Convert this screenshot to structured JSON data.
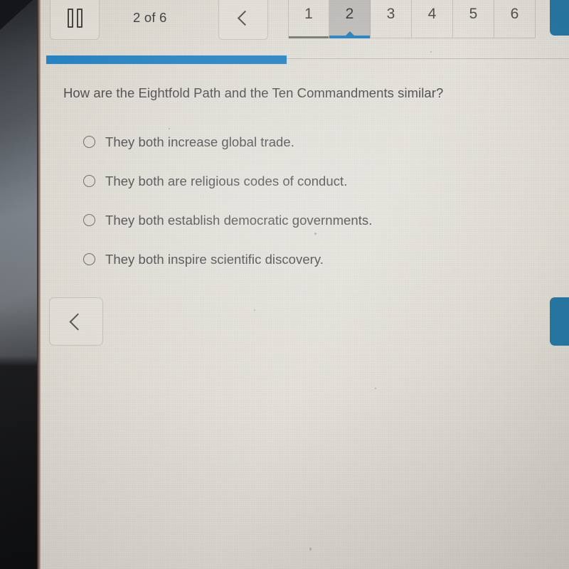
{
  "toolbar": {
    "pause_icon": "pause-icon",
    "pause_label": "",
    "counter_text": "2 of 6",
    "prev_icon": "chevron-left-icon",
    "next_icon": "chevron-right-icon"
  },
  "pagination": {
    "tabs": [
      {
        "label": "1",
        "state": "visited"
      },
      {
        "label": "2",
        "state": "current"
      },
      {
        "label": "3",
        "state": "unvisited"
      },
      {
        "label": "4",
        "state": "unvisited"
      },
      {
        "label": "5",
        "state": "unvisited"
      },
      {
        "label": "6",
        "state": "unvisited"
      }
    ]
  },
  "progress": {
    "percent": 46,
    "fill_color": "#1a7bbd"
  },
  "question": {
    "text": "How are the Eightfold Path and the Ten Commandments similar?",
    "number": 2,
    "total": 6
  },
  "options": [
    {
      "label": "They both increase global trade.",
      "selected": false
    },
    {
      "label": "They both are religious codes of conduct.",
      "selected": false
    },
    {
      "label": "They both establish democratic governments.",
      "selected": false
    },
    {
      "label": "They both inspire scientific discovery.",
      "selected": false
    }
  ],
  "footer": {
    "prev_icon": "chevron-left-icon",
    "next_icon": "chevron-right-icon"
  },
  "colors": {
    "accent_blue": "#1a7bbd",
    "button_blue": "#1b6f9e",
    "visited_gray": "#6e7072",
    "text": "#3d3c40",
    "screen_bg": "#ded9d1"
  }
}
